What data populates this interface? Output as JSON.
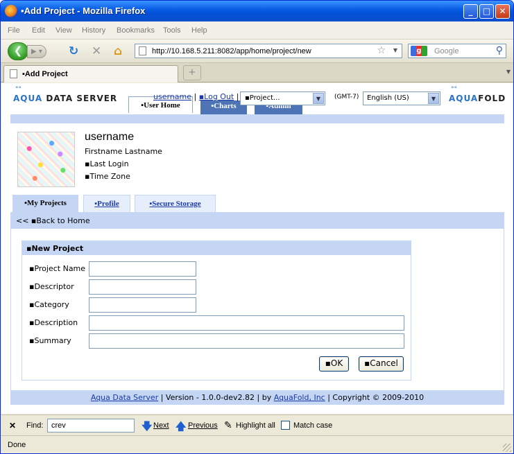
{
  "window": {
    "title": "▪Add Project - Mozilla Firefox"
  },
  "menu": [
    "File",
    "Edit",
    "View",
    "History",
    "Bookmarks",
    "Tools",
    "Help"
  ],
  "nav": {
    "url": "http://10.168.5.211:8082/app/home/project/new",
    "search_placeholder": "Google"
  },
  "tab": {
    "label": "▪Add Project",
    "new_tab": "+"
  },
  "header": {
    "brand_left": {
      "aqua": "AQUA",
      "rest": " DATA SERVER"
    },
    "brand_right": {
      "aqua": "AQUA",
      "rest": "FOLD"
    },
    "username_link": "username",
    "sep1": " | ",
    "logout_link": "▪Log Out",
    "sep2": " |",
    "tabs": {
      "user_home": "▪User Home",
      "charts": "▪Charts",
      "admin": "▪Admin"
    },
    "project_select": "▪Project...",
    "timezone": "(GMT-7)",
    "language_select": "English (US)"
  },
  "profile": {
    "username": "username",
    "fullname": "Firstname Lastname",
    "last_login": "▪Last Login",
    "time_zone": "▪Time Zone"
  },
  "subtabs": {
    "my_projects": "▪My Projects",
    "profile": "▪Profile",
    "secure_storage": "▪Secure Storage"
  },
  "back_home": "<< ▪Back to Home",
  "form": {
    "title": "▪New Project",
    "fields": {
      "project_name": {
        "label": "▪Project Name",
        "value": ""
      },
      "descriptor": {
        "label": "▪Descriptor",
        "value": ""
      },
      "category": {
        "label": "▪Category",
        "value": ""
      },
      "description": {
        "label": "▪Description",
        "value": ""
      },
      "summary": {
        "label": "▪Summary",
        "value": ""
      }
    },
    "ok": "▪OK",
    "cancel": "▪Cancel"
  },
  "footer": {
    "product_link": "Aqua Data Server",
    "version": " | Version - 1.0.0-dev2.82 | by ",
    "company_link": "AquaFold, Inc",
    "copyright": " | Copyright © 2009-2010"
  },
  "findbar": {
    "label": "Find:",
    "value": "crev",
    "next": "Next",
    "previous": "Previous",
    "highlight": "Highlight all",
    "match_case": "Match case"
  },
  "status": "Done"
}
